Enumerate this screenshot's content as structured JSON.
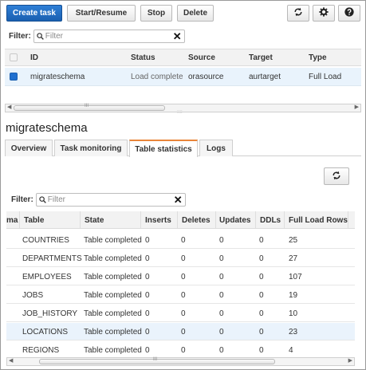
{
  "toolbar": {
    "create_task": "Create task",
    "start_resume": "Start/Resume",
    "stop": "Stop",
    "delete": "Delete",
    "icons": [
      "refresh-icon",
      "gear-icon",
      "help-icon"
    ]
  },
  "task_filter": {
    "label": "Filter:",
    "placeholder": "Filter",
    "clear": "✕"
  },
  "task_table": {
    "columns": [
      "ID",
      "Status",
      "Source",
      "Target",
      "Type"
    ],
    "rows": [
      {
        "id": "migrateschema",
        "status": "Load complete",
        "source": "orasource",
        "target": "aurtarget",
        "type": "Full Load"
      }
    ]
  },
  "detail": {
    "title": "migrateschema",
    "tabs": [
      "Overview",
      "Task monitoring",
      "Table statistics",
      "Logs"
    ],
    "active_tab": "Table statistics"
  },
  "stats_filter": {
    "label": "Filter:",
    "placeholder": "Filter",
    "clear": "✕"
  },
  "stats_table": {
    "columns": [
      "ma",
      "Table",
      "State",
      "Inserts",
      "Deletes",
      "Updates",
      "DDLs",
      "Full Load Rows"
    ],
    "rows": [
      {
        "table": "COUNTRIES",
        "state": "Table completed",
        "inserts": "0",
        "deletes": "0",
        "updates": "0",
        "ddls": "0",
        "full_load_rows": "25"
      },
      {
        "table": "DEPARTMENTS",
        "state": "Table completed",
        "inserts": "0",
        "deletes": "0",
        "updates": "0",
        "ddls": "0",
        "full_load_rows": "27"
      },
      {
        "table": "EMPLOYEES",
        "state": "Table completed",
        "inserts": "0",
        "deletes": "0",
        "updates": "0",
        "ddls": "0",
        "full_load_rows": "107"
      },
      {
        "table": "JOBS",
        "state": "Table completed",
        "inserts": "0",
        "deletes": "0",
        "updates": "0",
        "ddls": "0",
        "full_load_rows": "19"
      },
      {
        "table": "JOB_HISTORY",
        "state": "Table completed",
        "inserts": "0",
        "deletes": "0",
        "updates": "0",
        "ddls": "0",
        "full_load_rows": "10"
      },
      {
        "table": "LOCATIONS",
        "state": "Table completed",
        "inserts": "0",
        "deletes": "0",
        "updates": "0",
        "ddls": "0",
        "full_load_rows": "23"
      },
      {
        "table": "REGIONS",
        "state": "Table completed",
        "inserts": "0",
        "deletes": "0",
        "updates": "0",
        "ddls": "0",
        "full_load_rows": "4"
      }
    ]
  },
  "scrollbar_grip": "III",
  "splitter_grip": "::::",
  "colors": {
    "primary": "#1f6fcf",
    "active_tab_accent": "#e9853a",
    "selected_row": "#e9f3fc"
  }
}
